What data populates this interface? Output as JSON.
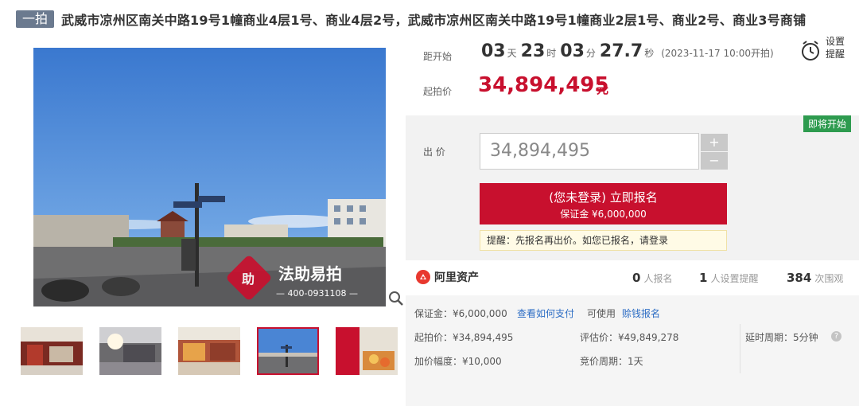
{
  "header": {
    "badge": "一拍",
    "title": "武威市凉州区南关中路19号1幢商业4层1号、商业4层2号，武威市凉州区南关中路19号1幢商业2层1号、商业2号、商业3号商铺"
  },
  "gallery": {
    "watermark_brand": "法助易拍",
    "watermark_phone": "— 400-0931108 —",
    "zoom_icon": "magnifier-icon",
    "thumbnail_count": 5,
    "active_thumbnail": 4
  },
  "countdown": {
    "label": "距开始",
    "days": "03",
    "days_unit": "天",
    "hours": "23",
    "hours_unit": "时",
    "minutes": "03",
    "minutes_unit": "分",
    "seconds": "27.7",
    "seconds_unit": "秒",
    "start_note": "(2023-11-17 10:00开拍)"
  },
  "reminder": {
    "line1": "设置",
    "line2": "提醒",
    "icon": "alarm-clock-icon"
  },
  "starting_price": {
    "label": "起拍价",
    "value": "34,894,495",
    "unit": "元"
  },
  "bid": {
    "status_badge": "即将开始",
    "label": "出 价",
    "input_value": "34,894,495",
    "plus": "+",
    "minus": "−",
    "register_line1": "(您未登录) 立即报名",
    "register_line2": "保证金 ¥6,000,000",
    "tip": "提醒：先报名再出价。如您已报名，请登录"
  },
  "platform": {
    "name": "阿里资产",
    "registered_count": "0",
    "registered_label": "人报名",
    "reminders_count": "1",
    "reminders_label": "人设置提醒",
    "views_count": "384",
    "views_label": "次围观"
  },
  "details": {
    "deposit": "保证金：¥6,000,000",
    "how_to_pay": "查看如何支付",
    "can_use": "可使用",
    "credit_register": "赊钱报名",
    "starting_price": "起拍价：¥34,894,495",
    "appraisal": "评估价：¥49,849,278",
    "extension": "延时周期：5分钟",
    "increment": "加价幅度：¥10,000",
    "bid_cycle": "竞价周期：1天"
  },
  "colors": {
    "accent_red": "#c8102e",
    "status_green": "#2e9b4f",
    "link_blue": "#2b6cc4"
  }
}
